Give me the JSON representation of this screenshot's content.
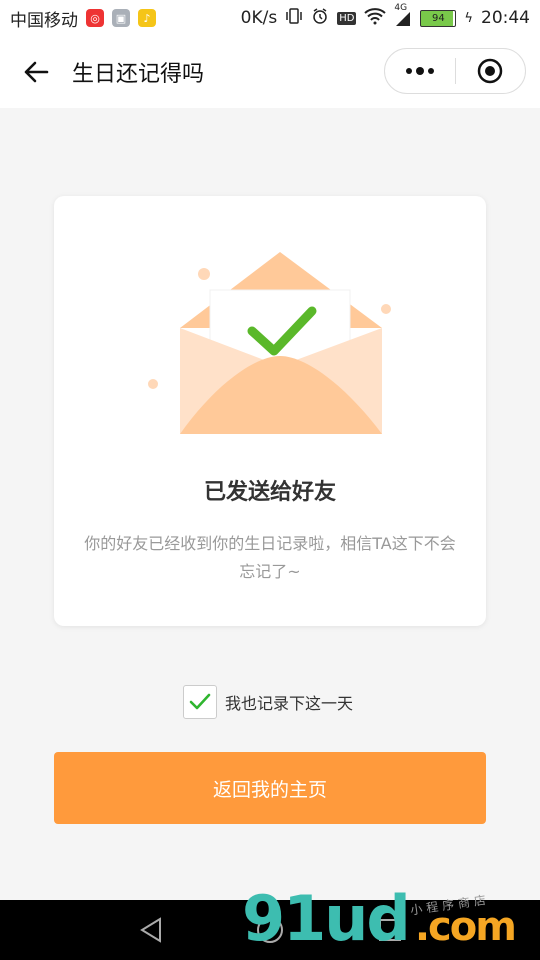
{
  "status_bar": {
    "carrier": "中国移动",
    "net_speed": "0K/s",
    "network": "4G",
    "battery": "94",
    "time": "20:44"
  },
  "header": {
    "title": "生日还记得吗"
  },
  "card": {
    "title": "已发送给好友",
    "description": "你的好友已经收到你的生日记录啦，相信TA这下不会忘记了~"
  },
  "remember": {
    "checked": true,
    "label": "我也记录下这一天"
  },
  "main_button": {
    "label": "返回我的主页"
  },
  "watermark": {
    "brand": "91ud",
    "suffix": ".com",
    "sub": "小程序商店"
  },
  "colors": {
    "accent": "#ff9a3c",
    "check_green": "#5ab82a",
    "envelope": "#ffc999"
  }
}
